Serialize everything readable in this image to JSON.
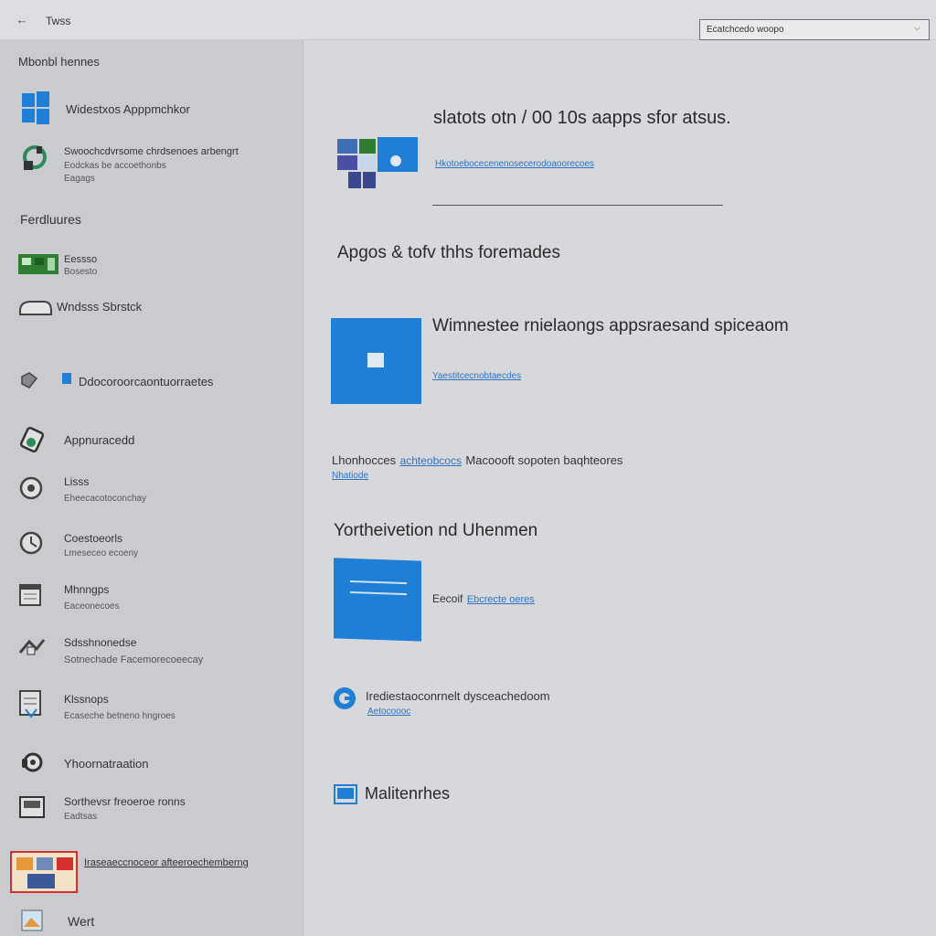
{
  "window": {
    "title": "Twss",
    "search_placeholder": "Ecatchcedo woopo"
  },
  "sidebar": {
    "heading_top": "Mbonbl hennes",
    "heading_features": "Ferdluures",
    "items": [
      {
        "label": "Widestxos Apppmchkor",
        "sub": ""
      },
      {
        "label": "Swoochcdvrsome chrdsenoes arbengrt",
        "sub": "Eodckas be accoethonbs",
        "sub2": "Eagags"
      },
      {
        "label": "Eessso",
        "sub": "Bosesto"
      },
      {
        "label": "Wndsss Sbrstck",
        "sub": ""
      },
      {
        "label": "Ddocoroorcaontuorraetes",
        "sub": ""
      },
      {
        "label": "Appnuracedd",
        "sub": ""
      },
      {
        "label": "Lisss",
        "sub": "Eheecacotoconchay"
      },
      {
        "label": "Coestoeorls",
        "sub": "Lmeseceo ecoeny"
      },
      {
        "label": "Mhnngps",
        "sub": "Eaceonecoes"
      },
      {
        "label": "Sdsshnonedse",
        "sub": "Sotnechade Facemorecoeecay"
      },
      {
        "label": "Klssnops",
        "sub": "Ecaseche betneno hngroes"
      },
      {
        "label": "Yhoornatraation",
        "sub": ""
      },
      {
        "label": "Sorthevsr freoeroe ronns",
        "sub": "Eadtsas"
      },
      {
        "label": "Iraseaeccnoceor afteeroechemberng",
        "sub": ""
      },
      {
        "label": "Wert",
        "sub": ""
      }
    ]
  },
  "main": {
    "headline": "slatots otn  / 00 10s aapps sfor atsus.",
    "headline_link": "Hkotoebocecenenosecerodoaoorecoes",
    "section1_title": "Apgos  & tofv thhs foremades",
    "card1_title": "Wimnestee rnielaongs appsraesand spiceaom",
    "card1_link": "Yaestitcecnobtaecdes",
    "line2_text": "Lhonhocces",
    "line2_link": "achteobcocs",
    "line2_rest": "Macoooft sopoten baqhteores",
    "line2_link2": "Nhatiode",
    "section2_title": "Yortheivetion nd Uhenmen",
    "card2_text": "Eecoif",
    "card2_link": "Ebcrecte oeres",
    "edge_text": "Irediestaoconrnelt dysceachedoom",
    "edge_link": "Aetocoooc",
    "footer_text": "Malitenrhes"
  },
  "colors": {
    "accent": "#1f7fd6",
    "link": "#2f73c7",
    "sidebar_bg": "#c9cbcf",
    "main_bg": "#d6d8db"
  }
}
